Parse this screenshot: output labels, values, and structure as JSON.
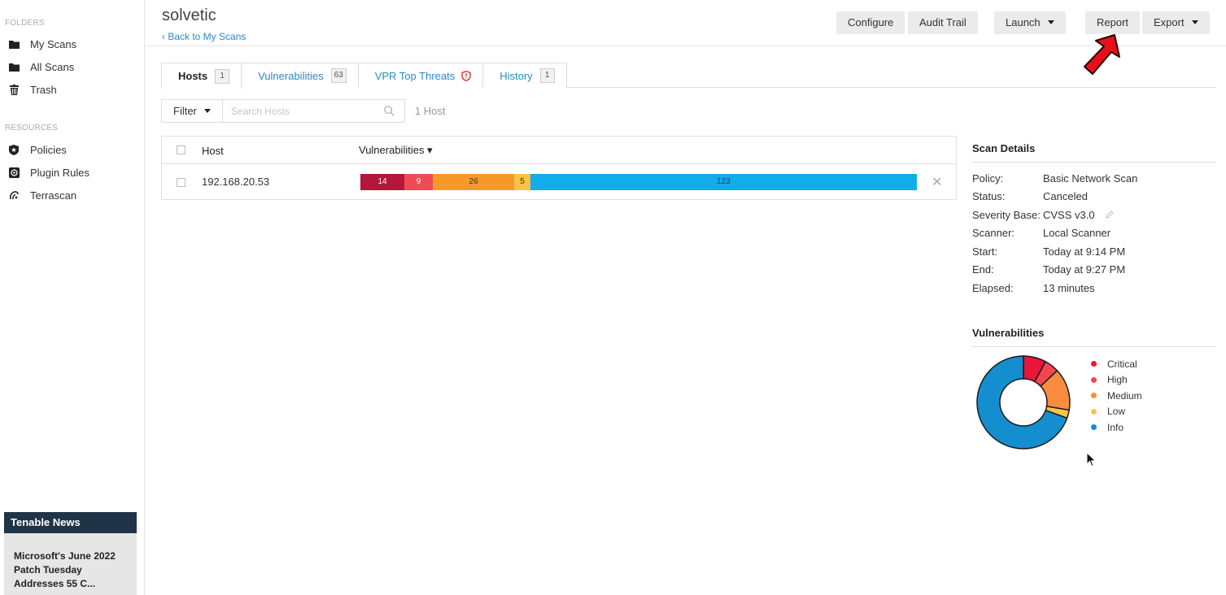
{
  "sidebar": {
    "folders_label": "FOLDERS",
    "folders": [
      {
        "label": "My Scans",
        "icon": "folder-icon"
      },
      {
        "label": "All Scans",
        "icon": "folder-icon"
      },
      {
        "label": "Trash",
        "icon": "trash-icon"
      }
    ],
    "resources_label": "RESOURCES",
    "resources": [
      {
        "label": "Policies",
        "icon": "policy-shield-icon"
      },
      {
        "label": "Plugin Rules",
        "icon": "plugin-rules-icon"
      },
      {
        "label": "Terrascan",
        "icon": "terrascan-icon"
      }
    ],
    "news": {
      "heading": "Tenable News",
      "item": "Microsoft's June 2022 Patch Tuesday Addresses 55 C..."
    }
  },
  "header": {
    "title": "solvetic",
    "back_link": "‹ Back to My Scans",
    "buttons": {
      "configure": "Configure",
      "audit_trail": "Audit Trail",
      "launch": "Launch",
      "report": "Report",
      "export": "Export"
    }
  },
  "tabs": [
    {
      "label": "Hosts",
      "badge": "1"
    },
    {
      "label": "Vulnerabilities",
      "badge": "63"
    },
    {
      "label": "VPR Top Threats"
    },
    {
      "label": "History",
      "badge": "1"
    }
  ],
  "filter": {
    "label": "Filter",
    "search_placeholder": "Search Hosts",
    "count": "1 Host"
  },
  "table": {
    "columns": {
      "host": "Host",
      "vulnerabilities": "Vulnerabilities ▾"
    },
    "rows": [
      {
        "host": "192.168.20.53",
        "severity_counts": {
          "critical": "14",
          "high": "9",
          "medium": "26",
          "low": "5",
          "info": "123"
        }
      }
    ]
  },
  "scan_details": {
    "heading": "Scan Details",
    "rows": [
      {
        "key": "Policy:",
        "value": "Basic Network Scan"
      },
      {
        "key": "Status:",
        "value": "Canceled"
      },
      {
        "key": "Severity Base:",
        "value": "CVSS v3.0"
      },
      {
        "key": "Scanner:",
        "value": "Local Scanner"
      },
      {
        "key": "Start:",
        "value": "Today at 9:14 PM"
      },
      {
        "key": "End:",
        "value": "Today at 9:27 PM"
      },
      {
        "key": "Elapsed:",
        "value": "13 minutes"
      }
    ]
  },
  "vulnerabilities_chart": {
    "heading": "Vulnerabilities",
    "legend": [
      "Critical",
      "High",
      "Medium",
      "Low",
      "Info"
    ]
  },
  "chart_data": {
    "type": "pie",
    "categories": [
      "Critical",
      "High",
      "Medium",
      "Low",
      "Info"
    ],
    "values": [
      14,
      9,
      26,
      5,
      123
    ]
  },
  "colors": {
    "critical": "#e8163b",
    "high": "#f2474f",
    "medium": "#f98c3e",
    "low": "#fbc34e",
    "info": "#148ecf",
    "bar_critical": "#b3173a",
    "bar_high": "#ef4a55",
    "bar_medium": "#f7982a",
    "bar_low": "#fcc342",
    "bar_info": "#12acea",
    "link": "#2a8ac4",
    "news_header": "#1f3446"
  }
}
